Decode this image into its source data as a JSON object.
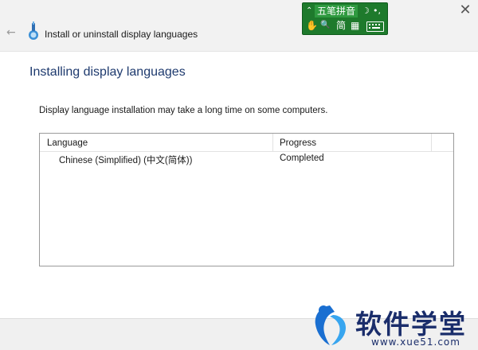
{
  "window": {
    "title": "Install or uninstall display languages",
    "back_icon": "back-arrow-icon",
    "close_icon": "close-icon",
    "close_glyph": "✕"
  },
  "ime": {
    "name": "五笔拼音",
    "row1_left": "⌃",
    "row1_moon": "☽",
    "row1_punct": "•,",
    "hand": "✋",
    "search": "🔍",
    "mode": "简",
    "grid": "▦",
    "bg_color": "#1e7a2c"
  },
  "content": {
    "heading": "Installing display languages",
    "description": "Display language installation may take a long time on some computers.",
    "columns": [
      "Language",
      "Progress"
    ],
    "rows": [
      {
        "language": "Chinese (Simplified) (中文(简体))",
        "progress": "Completed"
      }
    ]
  },
  "watermark": {
    "brand": "软件学堂",
    "url": "www.xue51.com"
  },
  "colors": {
    "heading": "#1e3a6e",
    "watermark": "#1a2d6b"
  }
}
